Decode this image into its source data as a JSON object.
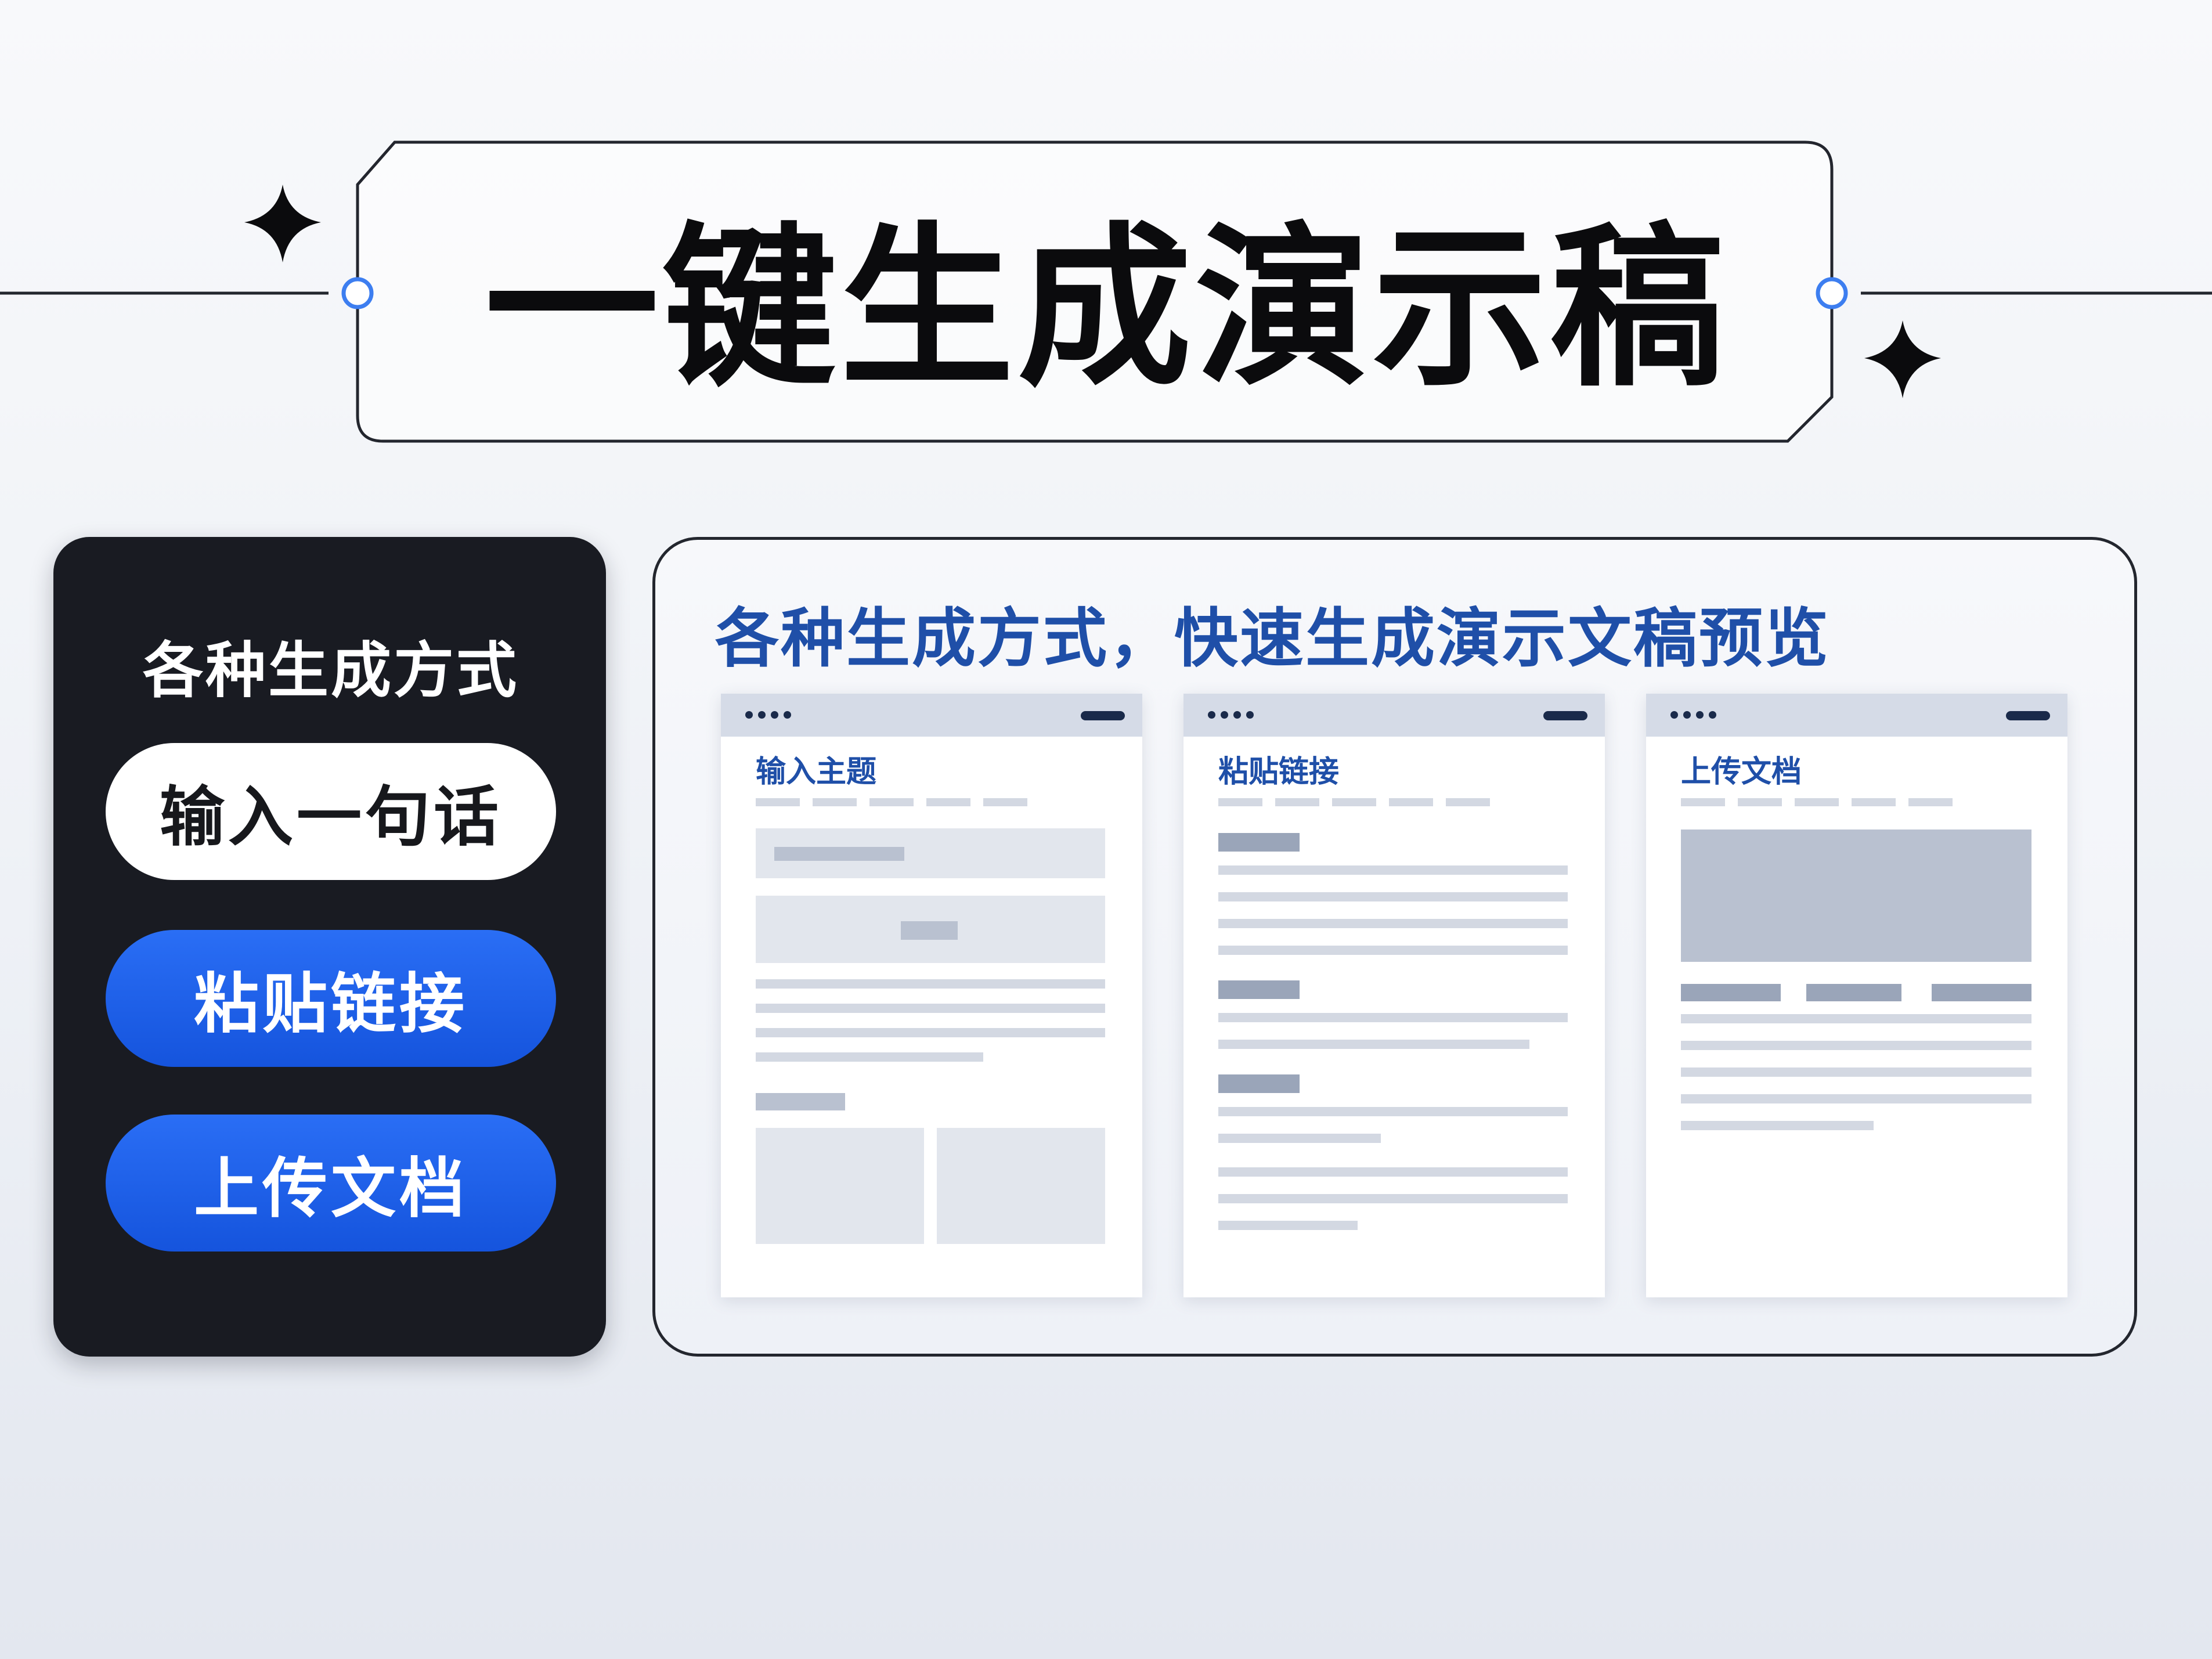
{
  "title": "一键生成演示稿",
  "left_panel": {
    "heading": "各种生成方式",
    "buttons": {
      "input_sentence": "输入一句话",
      "paste_link": "粘贴链接",
      "upload_doc": "上传文档"
    }
  },
  "right_panel": {
    "heading": "各种生成方式，快速生成演示文稿预览",
    "cards": [
      {
        "label": "输入主题"
      },
      {
        "label": "粘贴链接"
      },
      {
        "label": "上传文档"
      }
    ]
  },
  "colors": {
    "title": "#0b0b0d",
    "accent_blue": "#1554dd",
    "heading_blue": "#1f4fa8",
    "dark_panel": "#191b22",
    "outline_circle": "#3d7ef0"
  },
  "icons": [
    "sparkle-icon",
    "connector-circle-icon"
  ]
}
